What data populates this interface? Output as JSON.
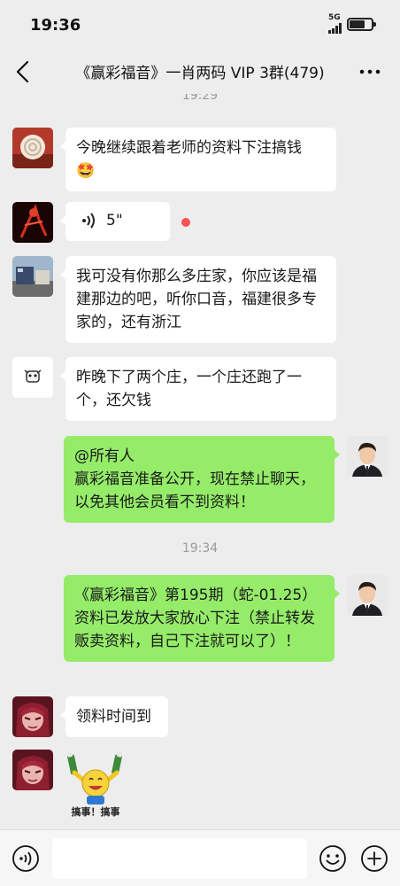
{
  "status_bar": {
    "time": "19:36",
    "network": "5G",
    "signal_bars": 4,
    "battery_level": 0.7
  },
  "nav": {
    "title": "《赢彩福音》一肖两码 VIP 3群(479)",
    "back_icon": "chevron-left-icon",
    "more_icon": "ellipsis-icon"
  },
  "chat": {
    "top_timestamp": "19:29",
    "messages": [
      {
        "side": "in",
        "avatar_icon": "snail-avatar",
        "text": "今晚继续跟着老师的资料下注搞钱",
        "emoji": "🤩"
      },
      {
        "side": "in",
        "avatar_icon": "red-figure-avatar",
        "type": "voice",
        "duration": "5\"",
        "unread": true
      },
      {
        "side": "in",
        "avatar_icon": "street-photo-avatar",
        "text": "我可没有你那么多庄家，你应该是福建那边的吧，听你口音，福建很多专家的，还有浙江"
      },
      {
        "side": "in",
        "avatar_icon": "cartoon-avatar",
        "text": "昨晚下了两个庄，一个庄还跑了一个，还欠钱"
      },
      {
        "side": "out",
        "avatar_icon": "man-in-suit-avatar",
        "mention": "@所有人",
        "text": "赢彩福音准备公开，现在禁止聊天，以免其他会员看不到资料！"
      },
      {
        "side": "out",
        "avatar_icon": "man-in-suit-avatar",
        "text": "《赢彩福音》第195期（蛇-01.25）资料已发放大家放心下注（禁止转发贩卖资料，自己下注就可以了）！"
      },
      {
        "side": "in",
        "avatar_icon": "anime-girl-avatar",
        "text": "领料时间到"
      },
      {
        "side": "in",
        "avatar_icon": "anime-girl-avatar",
        "type": "sticker",
        "sticker_caption": "搞事！搞事"
      }
    ],
    "mid_timestamp": "19:34"
  },
  "input_bar": {
    "voice_icon": "voice-toggle-icon",
    "emoji_icon": "emoji-icon",
    "plus_icon": "plus-icon",
    "value": ""
  },
  "colors": {
    "background": "#ededed",
    "incoming_bubble": "#ffffff",
    "outgoing_bubble": "#95ec69",
    "unread_dot": "#fa5151",
    "timestamp": "#9a9a9a"
  }
}
